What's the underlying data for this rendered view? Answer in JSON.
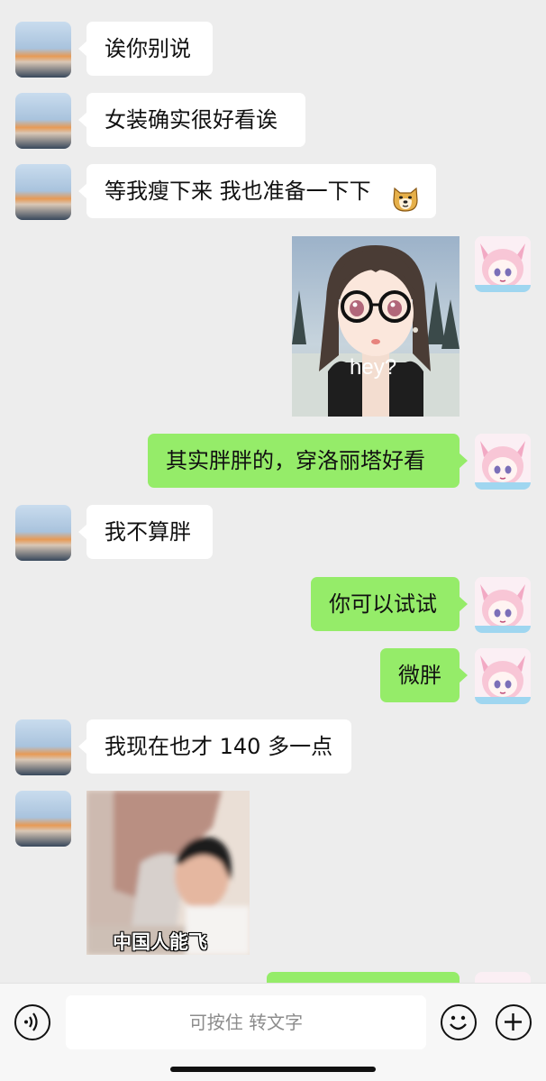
{
  "messages": [
    {
      "side": "other",
      "type": "text",
      "text": "诶你别说"
    },
    {
      "side": "other",
      "type": "text",
      "text": "女装确实很好看诶"
    },
    {
      "side": "other",
      "type": "text",
      "text": "等我瘦下来 我也准备一下下",
      "emoji": "doge-emoji"
    },
    {
      "side": "self",
      "type": "image",
      "caption": "hey?",
      "image": "anime-girl-glasses-sticker"
    },
    {
      "side": "self",
      "type": "text",
      "text": "其实胖胖的，穿洛丽塔好看"
    },
    {
      "side": "other",
      "type": "text",
      "text": "我不算胖"
    },
    {
      "side": "self",
      "type": "text",
      "text": "你可以试试"
    },
    {
      "side": "self",
      "type": "text",
      "text": "微胖"
    },
    {
      "side": "other",
      "type": "text",
      "text": "我现在也才 140 多一点"
    },
    {
      "side": "other",
      "type": "image",
      "caption": "中国人能飞",
      "image": "meme-photo"
    },
    {
      "side": "self",
      "type": "text",
      "text": ""
    }
  ],
  "input": {
    "placeholder": "可按住 转文字",
    "voice_icon": "voice-icon",
    "emoji_icon": "emoji-icon",
    "plus_icon": "plus-icon"
  }
}
